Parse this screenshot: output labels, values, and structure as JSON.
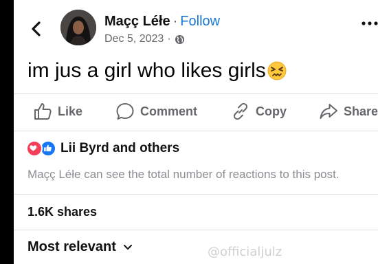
{
  "post": {
    "author": "Maçç Léłe",
    "separator": "·",
    "follow_label": "Follow",
    "date": "Dec 5, 2023",
    "meta_separator": "·",
    "privacy_icon": "globe-icon",
    "text": "im jus a girl who likes girls",
    "text_emoji": "confounded-face-emoji"
  },
  "actions": {
    "like_label": "Like",
    "comment_label": "Comment",
    "copy_label": "Copy",
    "share_label": "Share"
  },
  "reactions": {
    "summary": "Lii Byrd and others",
    "icons": [
      "love-reaction-icon",
      "like-reaction-icon"
    ],
    "notice": "Maçç Léłe can see the total number of reactions to this post."
  },
  "stats": {
    "shares": "1.6K shares"
  },
  "comments": {
    "sort_label": "Most relevant"
  },
  "watermark": "@officialjulz",
  "colors": {
    "follow": "#1876d2",
    "muted": "#65676b",
    "love": "#f33e58",
    "like": "#1877f2"
  }
}
